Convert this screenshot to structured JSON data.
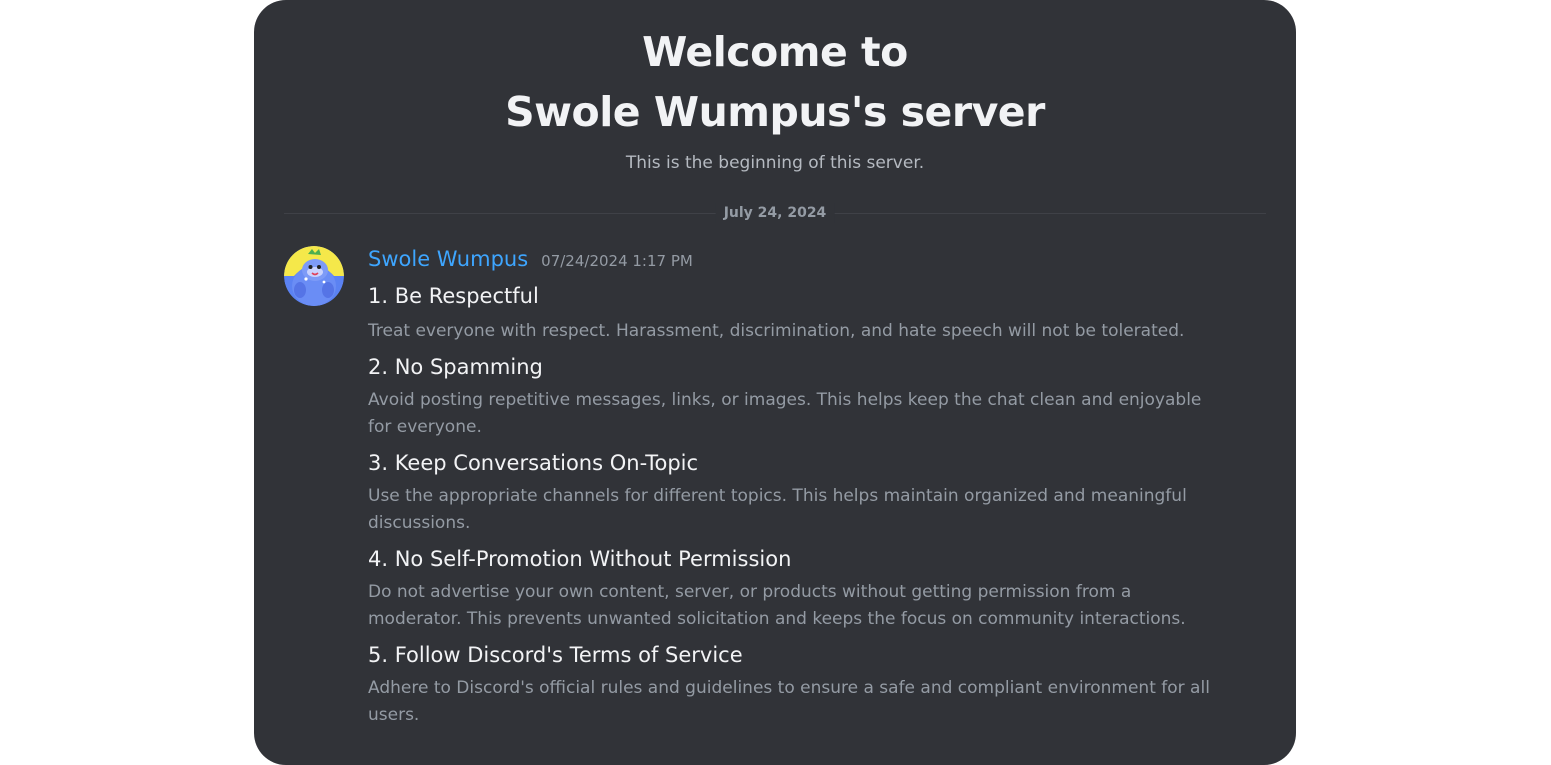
{
  "welcome": {
    "line1": "Welcome to",
    "line2": "Swole Wumpus's server",
    "subtitle": "This is the beginning of this server."
  },
  "divider": {
    "date": "July 24, 2024"
  },
  "message": {
    "avatar_icon": "wumpus-avatar-icon",
    "username": "Swole Wumpus",
    "username_color": "#3ea6ff",
    "timestamp": "07/24/2024 1:17 PM",
    "rules": [
      {
        "title": "1. Be Respectful",
        "description": "Treat everyone with respect. Harassment, discrimination, and hate speech will not be tolerated."
      },
      {
        "title": "2. No Spamming",
        "description": "Avoid posting repetitive messages, links, or images. This helps keep the chat clean and enjoyable for everyone."
      },
      {
        "title": "3. Keep Conversations On-Topic",
        "description": "Use the appropriate channels for different topics. This helps maintain organized and meaningful discussions."
      },
      {
        "title": "4. No Self-Promotion Without Permission",
        "description": "Do not advertise your own content, server, or products without getting permission from a moderator. This prevents unwanted solicitation and keeps the focus on community interactions."
      },
      {
        "title": "5. Follow Discord's Terms of Service",
        "description": "Adhere to Discord's official rules and guidelines to ensure a safe and compliant environment for all users."
      }
    ]
  },
  "colors": {
    "background": "#313338",
    "heading": "#f2f3f5",
    "muted": "#949ba4"
  }
}
